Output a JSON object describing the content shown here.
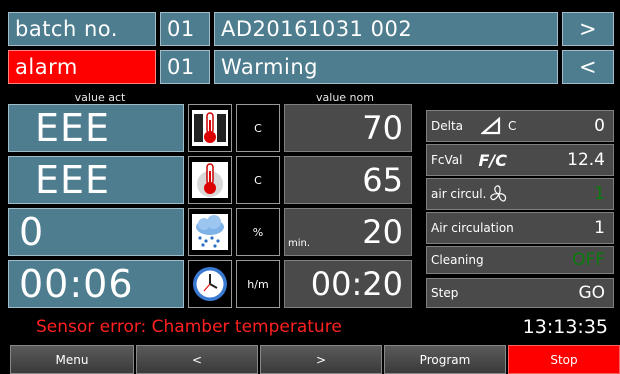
{
  "header": {
    "batch_label": "batch no.",
    "batch_num": "01",
    "batch_value": "AD20161031 002",
    "alarm_label": "alarm",
    "alarm_num": "01",
    "alarm_value": "Warming",
    "next_btn": ">",
    "prev_btn": "<"
  },
  "columns": {
    "act": "value act",
    "nom": "value nom"
  },
  "rows": [
    {
      "act": "EEE",
      "unit": "C",
      "nom": "70",
      "nom_sub": ""
    },
    {
      "act": "EEE",
      "unit": "C",
      "nom": "65",
      "nom_sub": ""
    },
    {
      "act": "0",
      "unit": "%",
      "nom": "20",
      "nom_sub": "min."
    },
    {
      "act": "00:06",
      "unit": "h/m",
      "nom": "00:20",
      "nom_sub": ""
    }
  ],
  "right_panel": [
    {
      "label": "Delta",
      "extra": "C",
      "value": "0"
    },
    {
      "label": "FcVal",
      "extra": "F/C",
      "value": "12.4"
    },
    {
      "label": "air circul.",
      "value": "1"
    },
    {
      "label": "Air circulation",
      "value": "1"
    },
    {
      "label": "Cleaning",
      "value": "OFF"
    },
    {
      "label": "Step",
      "value": "GO"
    }
  ],
  "status": {
    "message": "Sensor error: Chamber temperature",
    "time": "13:13:35"
  },
  "footer": [
    "Menu",
    "<",
    ">",
    "Program",
    "Stop"
  ],
  "colors": {
    "alarm_red": "#ff0000",
    "teal": "#4d7d8f",
    "green_value": "#0a7d0a",
    "error_text": "#ff2020"
  }
}
